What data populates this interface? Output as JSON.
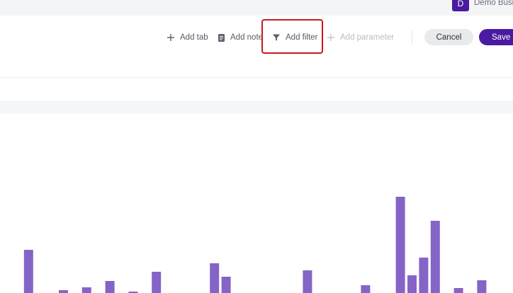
{
  "header": {
    "avatar_letter": "D",
    "business_name": "Demo Busin"
  },
  "toolbar": {
    "add_tab": "Add tab",
    "add_note": "Add note",
    "add_filter": "Add filter",
    "add_parameter": "Add parameter",
    "cancel": "Cancel",
    "save": "Save"
  },
  "colors": {
    "accent": "#4a1ba0",
    "bar": "#8564c8",
    "highlight": "#c8191e"
  },
  "chart_data": {
    "type": "bar",
    "values": [
      0,
      0,
      61,
      0,
      0,
      4,
      0,
      8,
      0,
      17,
      0,
      2,
      0,
      30,
      0,
      0,
      0,
      0,
      42,
      23,
      0,
      0,
      0,
      0,
      0,
      0,
      32,
      0,
      0,
      0,
      0,
      11,
      0,
      0,
      136,
      25,
      50,
      102,
      0,
      7,
      0,
      18,
      0
    ],
    "ylim": [
      0,
      160
    ]
  }
}
